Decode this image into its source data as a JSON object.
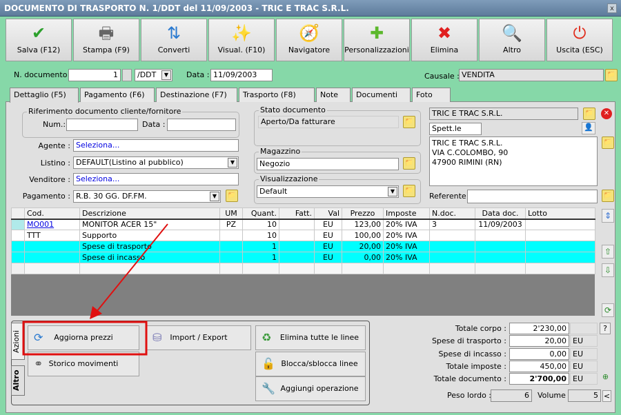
{
  "window": {
    "title": "DOCUMENTO DI TRASPORTO N. 1/DDT del 11/09/2003 - TRIC E TRAC S.R.L.",
    "close": "x"
  },
  "toolbar": [
    {
      "label": "Salva (F12)",
      "icon": "check-icon",
      "glyph": "✔",
      "color": "#2ca02c"
    },
    {
      "label": "Stampa (F9)",
      "icon": "printer-icon",
      "glyph": "🖶",
      "color": "#666"
    },
    {
      "label": "Converti",
      "icon": "convert-icon",
      "glyph": "⇅",
      "color": "#2a7ad0"
    },
    {
      "label": "Visual. (F10)",
      "icon": "magic-wand-icon",
      "glyph": "✨",
      "color": "#d8a000"
    },
    {
      "label": "Navigatore",
      "icon": "compass-icon",
      "glyph": "🧭",
      "color": "#7070c0"
    },
    {
      "label": "Personalizzazioni",
      "icon": "puzzle-icon",
      "glyph": "✚",
      "color": "#5cb82c"
    },
    {
      "label": "Elimina",
      "icon": "delete-x-icon",
      "glyph": "✖",
      "color": "#e02020"
    },
    {
      "label": "Altro",
      "icon": "magnifier-book-icon",
      "glyph": "🔍",
      "color": "#2060c0"
    },
    {
      "label": "Uscita (ESC)",
      "icon": "power-icon",
      "glyph": "⏻",
      "color": "#e03020"
    }
  ],
  "header": {
    "ndoc_label": "N. documento :",
    "ndoc_value": "1",
    "series": "/DDT",
    "data_label": "Data :",
    "data_value": "11/09/2003",
    "causale_label": "Causale :",
    "causale_value": "VENDITA"
  },
  "tabs": [
    "Dettaglio (F5)",
    "Pagamento (F6)",
    "Destinazione (F7)",
    "Trasporto (F8)",
    "Note",
    "Documenti",
    "Foto"
  ],
  "rif": {
    "title": "Riferimento documento cliente/fornitore",
    "num_label": "Num.:",
    "num_value": "",
    "data_label": "Data :",
    "data_value": ""
  },
  "fields": {
    "agente_label": "Agente :",
    "agente_value": "Seleziona...",
    "listino_label": "Listino :",
    "listino_value": "DEFAULT(Listino al pubblico)",
    "venditore_label": "Venditore :",
    "venditore_value": "Seleziona...",
    "pagamento_label": "Pagamento :",
    "pagamento_value": "R.B. 30 GG. DF.FM."
  },
  "stato": {
    "title": "Stato documento",
    "value": "Aperto/Da fatturare"
  },
  "magazzino": {
    "title": "Magazzino",
    "value": "Negozio"
  },
  "visualizzazione": {
    "title": "Visualizzazione",
    "value": "Default"
  },
  "cliente": {
    "name": "TRIC E TRAC S.R.L.",
    "title": "Spett.le",
    "address": [
      "TRIC E TRAC S.R.L.",
      "VIA C.COLOMBO, 90",
      "47900 RIMINI (RN)"
    ],
    "referente_label": "Referente",
    "referente_value": ""
  },
  "grid": {
    "columns": [
      "Cod.",
      "Descrizione",
      "UM",
      "Quant.",
      "Fatt.",
      "Val",
      "Prezzo",
      "Imposte",
      "N.doc.",
      "Data doc.",
      "Lotto"
    ],
    "rows": [
      [
        "MO001",
        "MONITOR ACER 15\"",
        "PZ",
        "10",
        "",
        "EU",
        "123,00",
        "20% IVA",
        "3",
        "11/09/2003",
        ""
      ],
      [
        "TTT",
        "Supporto",
        "",
        "10",
        "",
        "EU",
        "100,00",
        "20% IVA",
        "",
        "",
        ""
      ],
      [
        "",
        "Spese di trasporto",
        "",
        "1",
        "",
        "EU",
        "20,00",
        "20% IVA",
        "",
        "",
        ""
      ],
      [
        "",
        "Spese di incasso",
        "",
        "1",
        "",
        "EU",
        "0,00",
        "20% IVA",
        "",
        "",
        ""
      ],
      [
        "",
        "",
        "",
        "",
        "",
        "",
        "",
        "",
        "",
        "",
        ""
      ]
    ]
  },
  "actions": {
    "side_tabs": [
      "Azioni",
      "Altro"
    ],
    "buttons": [
      "Aggiorna prezzi",
      "Import / Export",
      "Elimina tutte le linee",
      "Storico movimenti",
      "Blocca/sblocca linee",
      "Aggiungi operazione"
    ]
  },
  "totals": {
    "rows": [
      {
        "label": "Totale corpo :",
        "value": "2'230,00",
        "unit": ""
      },
      {
        "label": "Spese di trasporto :",
        "value": "20,00",
        "unit": "EU"
      },
      {
        "label": "Spese di incasso :",
        "value": "0,00",
        "unit": "EU"
      },
      {
        "label": "Totale imposte :",
        "value": "450,00",
        "unit": "EU"
      },
      {
        "label": "Totale documento :",
        "value": "2'700,00",
        "unit": "EU"
      }
    ],
    "help": "?",
    "peso_label": "Peso lordo :",
    "peso_value": "6",
    "volume_label": "Volume :",
    "volume_value": "5",
    "volume_btn": "<"
  },
  "annotation_color": "#e01010"
}
